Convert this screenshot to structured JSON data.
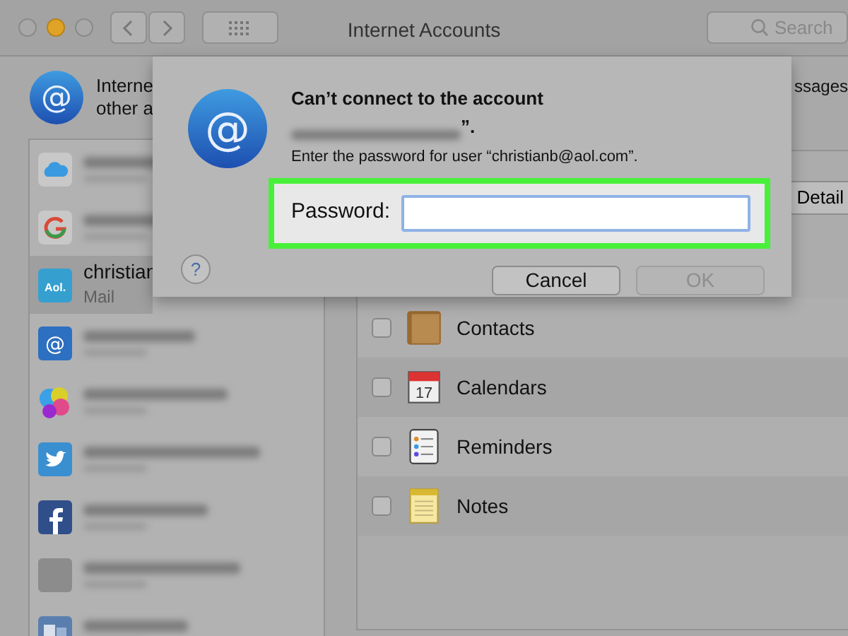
{
  "window": {
    "title": "Internet Accounts",
    "search": {
      "placeholder": "Search"
    }
  },
  "header": {
    "icon_glyph": "@",
    "lines": [
      "Interne",
      "other a"
    ],
    "right_text": "ssages"
  },
  "accounts": [
    {
      "kind": "icloud",
      "selected": false
    },
    {
      "kind": "google",
      "selected": false
    },
    {
      "kind": "aol",
      "icon_text": "Aol.",
      "name": "christian",
      "detail": "Mail",
      "selected": true
    },
    {
      "kind": "at",
      "icon_text": "@",
      "selected": false
    },
    {
      "kind": "gamecenter",
      "selected": false
    },
    {
      "kind": "twitter",
      "selected": false
    },
    {
      "kind": "facebook",
      "selected": false
    },
    {
      "kind": "generic",
      "selected": false
    },
    {
      "kind": "exchange",
      "selected": false
    }
  ],
  "detail_button": "Detail",
  "services": [
    {
      "kind": "contacts",
      "name": "Contacts",
      "checked": false
    },
    {
      "kind": "calendars",
      "name": "Calendars",
      "checked": false,
      "icon_text": "17"
    },
    {
      "kind": "reminders",
      "name": "Reminders",
      "checked": false
    },
    {
      "kind": "notes",
      "name": "Notes",
      "checked": false
    }
  ],
  "dialog": {
    "icon_glyph": "@",
    "title": "Can’t connect to the account",
    "subtitle_tail": "”.",
    "message": "Enter the password for user “christianb@aol.com”.",
    "password_label": "Password:",
    "highlighted": true,
    "help": "?",
    "buttons": [
      {
        "label": "Cancel",
        "disabled": false
      },
      {
        "label": "OK",
        "disabled": true
      }
    ]
  }
}
